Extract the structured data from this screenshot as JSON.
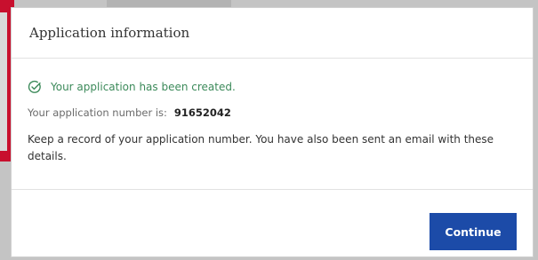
{
  "modal": {
    "title": "Application information",
    "success_message": "Your application has been created.",
    "application_number_label": "Your application number is:",
    "application_number": "91652042",
    "record_message": "Keep a record of your application number. You have also been sent an email with these details.",
    "continue_label": "Continue"
  },
  "icons": {
    "success": "check-circle-icon"
  },
  "colors": {
    "success_green": "#3c8a5a",
    "primary_button": "#1c4ba8",
    "alert_red": "#c8102e"
  }
}
